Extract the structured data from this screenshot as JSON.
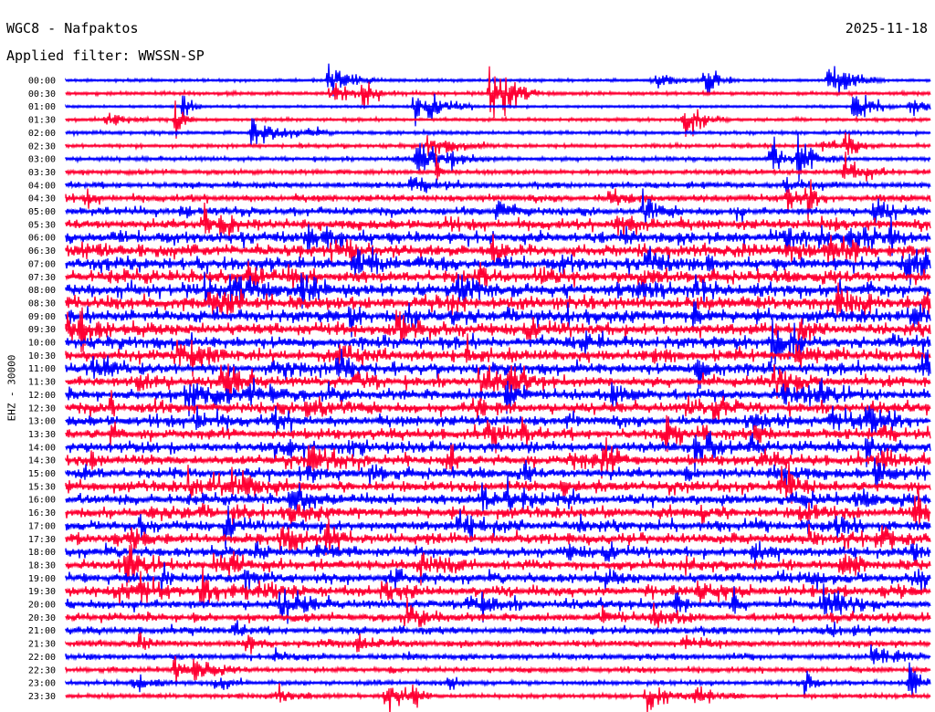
{
  "header": {
    "station": "WGC8 - Nafpaktos",
    "date": "2025-11-18",
    "filter": "Applied filter: WWSSN-SP"
  },
  "chart_data": {
    "type": "line",
    "ylabel": "EHZ - 30000",
    "line_times": [
      "00:00",
      "00:30",
      "01:00",
      "01:30",
      "02:00",
      "02:30",
      "03:00",
      "03:30",
      "04:00",
      "04:30",
      "05:00",
      "05:30",
      "06:00",
      "06:30",
      "07:00",
      "07:30",
      "08:00",
      "08:30",
      "09:00",
      "09:30",
      "10:00",
      "10:30",
      "11:00",
      "11:30",
      "12:00",
      "12:30",
      "13:00",
      "13:30",
      "14:00",
      "14:30",
      "15:00",
      "15:30",
      "16:00",
      "16:30",
      "17:00",
      "17:30",
      "18:00",
      "18:30",
      "19:00",
      "19:30",
      "20:00",
      "20:30",
      "21:00",
      "21:30",
      "22:00",
      "22:30",
      "23:00",
      "23:30"
    ],
    "line_colors": [
      "#0000ff",
      "#ff0033"
    ],
    "noise_level": [
      0.25,
      0.35,
      0.2,
      0.3,
      0.35,
      0.4,
      0.45,
      0.5,
      0.7,
      0.85,
      1.0,
      1.3,
      1.6,
      1.7,
      1.7,
      1.7,
      1.8,
      1.8,
      1.7,
      1.7,
      1.6,
      1.6,
      1.5,
      1.4,
      1.4,
      1.4,
      1.4,
      1.4,
      1.4,
      1.4,
      1.4,
      1.4,
      1.4,
      1.4,
      1.4,
      1.4,
      1.3,
      1.3,
      1.3,
      1.3,
      1.2,
      1.0,
      0.9,
      0.8,
      0.7,
      0.6,
      0.5,
      0.45
    ]
  }
}
